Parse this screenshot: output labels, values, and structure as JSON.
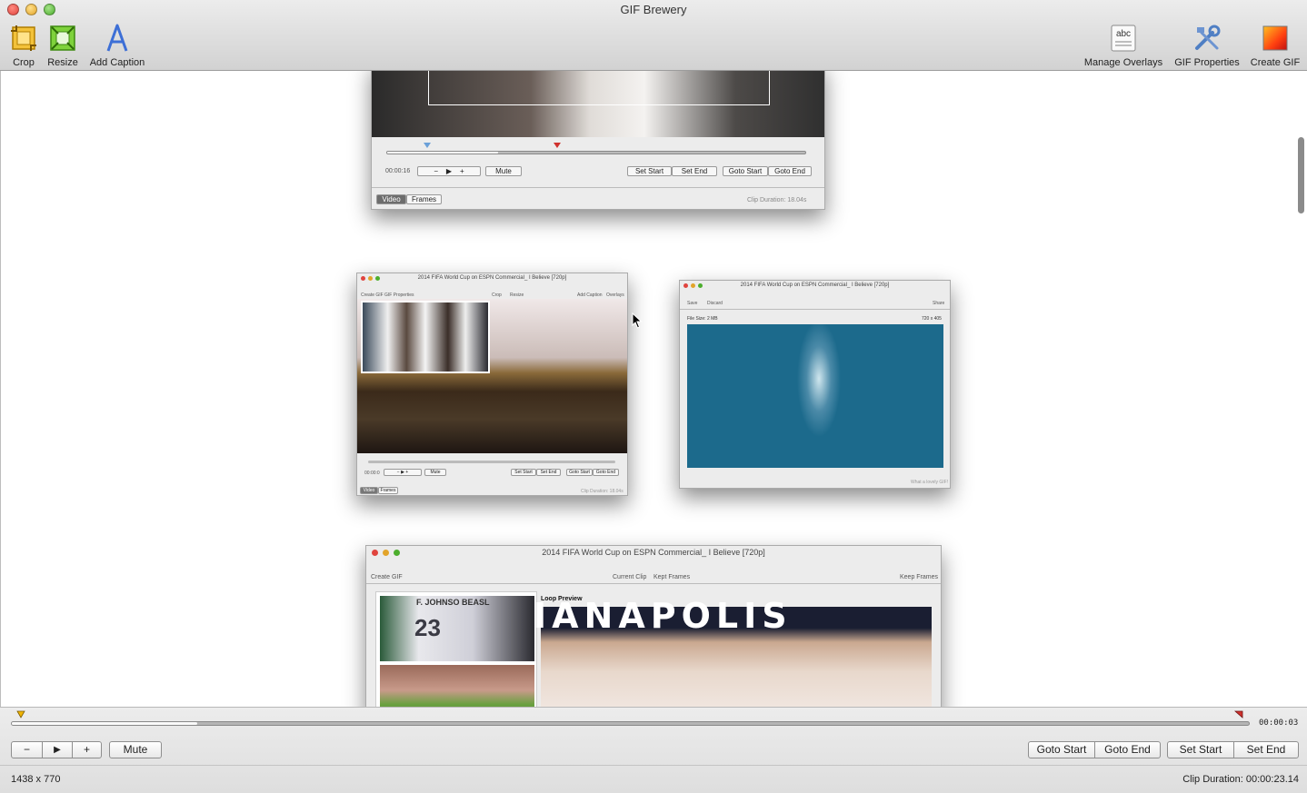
{
  "window": {
    "title": "GIF Brewery"
  },
  "toolbar": {
    "left": [
      {
        "label": "Crop",
        "icon": "crop-icon"
      },
      {
        "label": "Resize",
        "icon": "resize-icon"
      },
      {
        "label": "Add Caption",
        "icon": "caption-icon"
      }
    ],
    "right": [
      {
        "label": "Manage Overlays",
        "icon": "overlays-icon"
      },
      {
        "label": "GIF Properties",
        "icon": "tools-icon"
      },
      {
        "label": "Create GIF",
        "icon": "create-gif-icon"
      }
    ]
  },
  "overlay_icon_text": "abc",
  "screenshot1": {
    "time": "00:00:16",
    "mute": "Mute",
    "set_start": "Set Start",
    "set_end": "Set End",
    "goto_start": "Goto Start",
    "goto_end": "Goto End",
    "tab_video": "Video",
    "tab_frames": "Frames",
    "duration": "Clip Duration: 18.04s"
  },
  "screenshot2": {
    "title": "2014 FIFA World Cup on ESPN Commercial_ I Believe [720p]",
    "tools": [
      "Create GIF",
      "GIF Properties",
      "",
      "Crop",
      "Resize",
      "Add Caption",
      "Overlays"
    ],
    "time": "00:00:0",
    "mute": "Mute",
    "set_start": "Set Start",
    "set_end": "Set End",
    "goto_start": "Goto Start",
    "goto_end": "Goto End",
    "tab_video": "Video",
    "tab_frames": "Frames",
    "duration": "Clip Duration: 18.04s"
  },
  "screenshot3": {
    "title": "2014 FIFA World Cup on ESPN Commercial_ I Believe [720p]",
    "save": "Save",
    "discard": "Discard",
    "share": "Share",
    "file_size": "File Size: 2 MB",
    "dimensions": "720 x 405",
    "footer": "What a lovely GIF!"
  },
  "screenshot4": {
    "title": "2014 FIFA World Cup on ESPN Commercial_ I Believe [720p]",
    "create_gif": "Create GIF",
    "current_clip": "Current Clip",
    "kept_frames": "Kept Frames",
    "keep_frames": "Keep Frames",
    "loop_preview": "Loop Preview",
    "banner_text": "IANAPOLIS",
    "jersey_text": "F. JOHNSO  BEASL",
    "jersey_number": "23"
  },
  "timeline": {
    "time": "00:00:03",
    "progress": 0.15
  },
  "controls": {
    "minus": "−",
    "plus": "+",
    "mute": "Mute",
    "goto_start": "Goto Start",
    "goto_end": "Goto End",
    "set_start": "Set Start",
    "set_end": "Set End"
  },
  "status": {
    "dimensions": "1438 x 770",
    "duration": "Clip Duration: 00:00:23.14"
  },
  "colors": {
    "accent_red": "#d0312d",
    "marker_yellow": "#f0b400",
    "track": "#b5b5b5"
  }
}
